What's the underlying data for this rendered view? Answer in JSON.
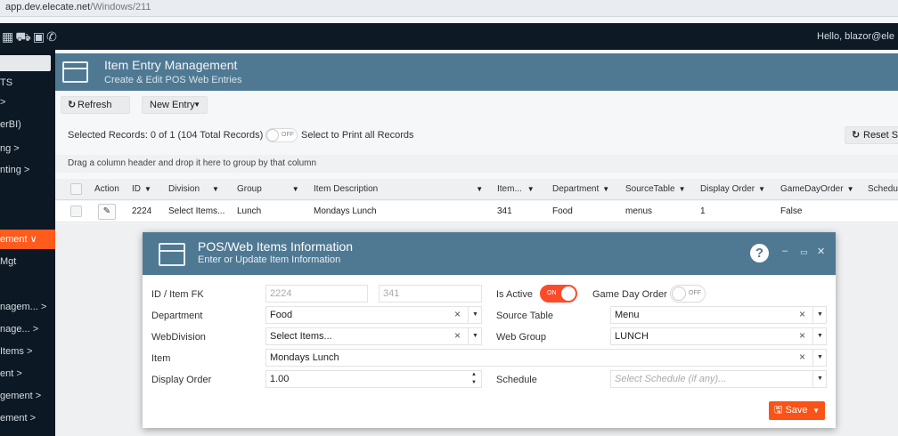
{
  "browser": {
    "url_host": "app.dev.elecate.net",
    "url_path": "/Windows/211"
  },
  "topbar": {
    "greeting": "Hello, blazor@ele"
  },
  "sidebar": {
    "items": [
      {
        "label": "TS"
      },
      {
        "label": ">"
      },
      {
        "label": "erBI)"
      },
      {
        "label": "ng  >"
      },
      {
        "label": "nting  >"
      },
      {
        "label": "ement  ∨"
      },
      {
        "label": " Mgt"
      },
      {
        "label": "nagem...  >"
      },
      {
        "label": "nage...  >"
      },
      {
        "label": " Items  >"
      },
      {
        "label": "ent  >"
      },
      {
        "label": "gement  >"
      },
      {
        "label": "ement  >"
      }
    ]
  },
  "page": {
    "title": "Item Entry Management",
    "subtitle": "Create & Edit POS Web Entries"
  },
  "toolbar": {
    "refresh_label": "Refresh",
    "new_entry_label": "New Entry"
  },
  "selection": {
    "text": "Selected Records: 0 of 1 (104 Total Records)",
    "toggle_label": "OFF",
    "print_all_label": "Select to Print all Records",
    "reset_label": "Reset S"
  },
  "grid": {
    "group_hint": "Drag a column header and drop it here to group by that column",
    "columns": [
      "Action",
      "ID",
      "Division",
      "Group",
      "Item Description",
      "Item...",
      "Department",
      "SourceTable",
      "Display Order",
      "GameDayOrder",
      "Schedu"
    ],
    "row": {
      "id": "2224",
      "division": "Select Items...",
      "group": "Lunch",
      "item_description": "Mondays Lunch",
      "item": "341",
      "department": "Food",
      "source_table": "menus",
      "display_order": "1",
      "game_day_order": "False"
    }
  },
  "modal": {
    "title": "POS/Web Items Information",
    "subtitle": "Enter or Update Item Information",
    "help_label": "?",
    "fields": {
      "id_label": "ID / Item FK",
      "id_value": "2224",
      "item_fk_value": "341",
      "is_active_label": "Is Active",
      "is_active_toggle": "ON",
      "game_day_label": "Game Day Order",
      "game_day_toggle": "OFF",
      "department_label": "Department",
      "department_value": "Food",
      "source_table_label": "Source Table",
      "source_table_value": "Menu",
      "webdivision_label": "WebDivision",
      "webdivision_value": "Select Items...",
      "web_group_label": "Web Group",
      "web_group_value": "LUNCH",
      "item_label": "Item",
      "item_value": "Mondays Lunch",
      "display_order_label": "Display Order",
      "display_order_value": "1.00",
      "schedule_label": "Schedule",
      "schedule_placeholder": "Select Schedule (if any)..."
    },
    "save_label": "Save"
  },
  "colors": {
    "header_blue": "#4f7993",
    "accent_orange": "#fa5318",
    "dark_nav": "#0c1823"
  }
}
